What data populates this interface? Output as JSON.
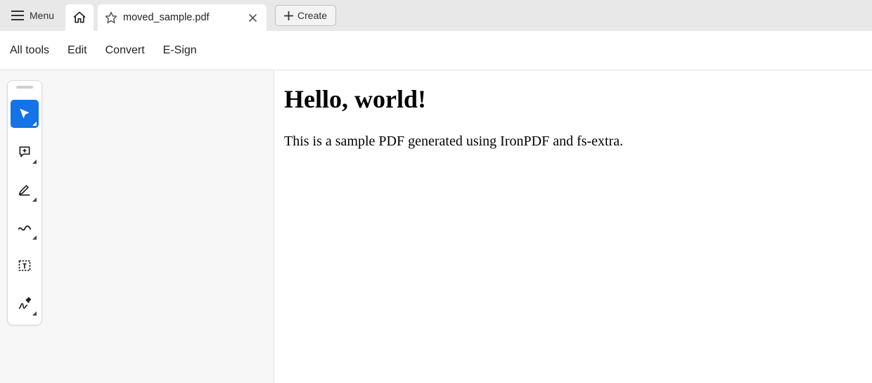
{
  "titlebar": {
    "menu_label": "Menu",
    "doc_tab_title": "moved_sample.pdf",
    "create_label": "Create"
  },
  "menubar": {
    "items": [
      "All tools",
      "Edit",
      "Convert",
      "E-Sign"
    ]
  },
  "tools": {
    "select": "select-tool",
    "comment": "comment-tool",
    "highlight": "highlight-tool",
    "draw": "draw-tool",
    "textbox": "textbox-tool",
    "sign": "sign-tool"
  },
  "document": {
    "heading": "Hello, world!",
    "body": "This is a sample PDF generated using IronPDF and fs-extra."
  },
  "colors": {
    "accent": "#1473e6"
  }
}
